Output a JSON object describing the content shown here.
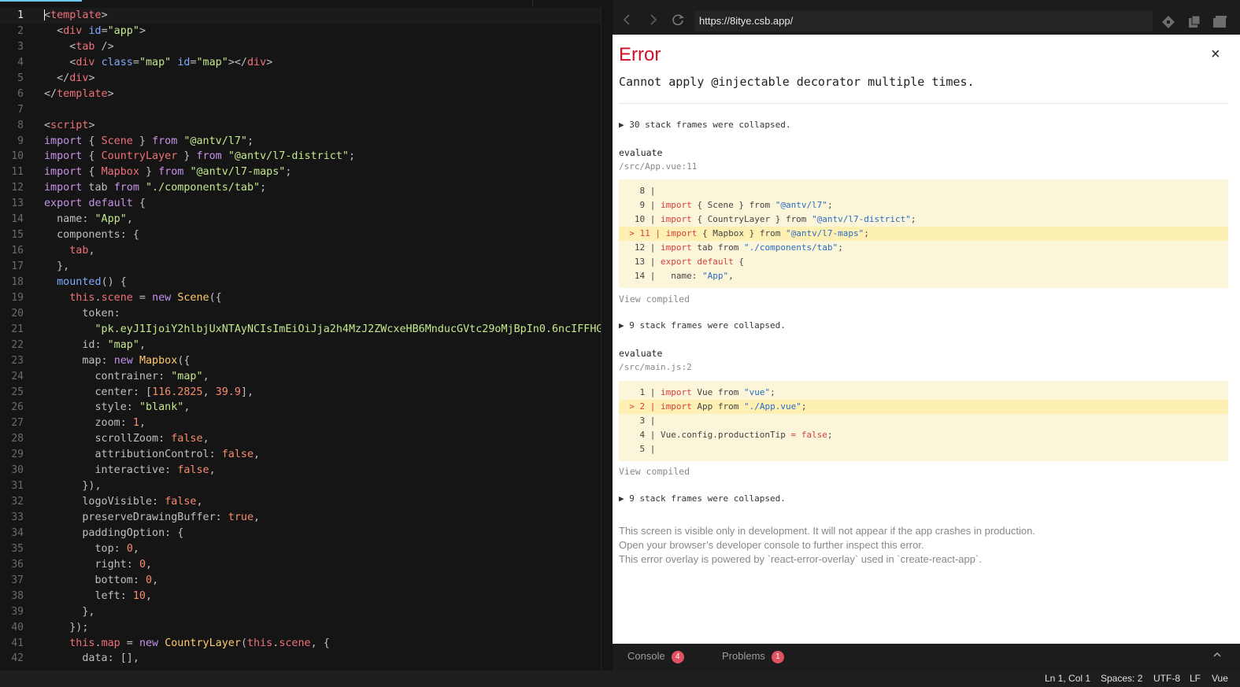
{
  "editor": {
    "lines": [
      {
        "n": "1",
        "tokens": [
          [
            "t-punc",
            "<"
          ],
          [
            "t-tag",
            "template"
          ],
          [
            "t-punc",
            ">"
          ]
        ]
      },
      {
        "n": "2",
        "tokens": [
          [
            "t-punc",
            "  <"
          ],
          [
            "t-tag",
            "div"
          ],
          [
            "t-punc",
            " "
          ],
          [
            "t-attr",
            "id"
          ],
          [
            "t-punc",
            "="
          ],
          [
            "t-str",
            "\"app\""
          ],
          [
            "t-punc",
            ">"
          ]
        ]
      },
      {
        "n": "3",
        "tokens": [
          [
            "t-punc",
            "    <"
          ],
          [
            "t-tag",
            "tab"
          ],
          [
            "t-punc",
            " />"
          ]
        ]
      },
      {
        "n": "4",
        "tokens": [
          [
            "t-punc",
            "    <"
          ],
          [
            "t-tag",
            "div"
          ],
          [
            "t-punc",
            " "
          ],
          [
            "t-attr",
            "class"
          ],
          [
            "t-punc",
            "="
          ],
          [
            "t-str",
            "\"map\""
          ],
          [
            "t-punc",
            " "
          ],
          [
            "t-attr",
            "id"
          ],
          [
            "t-punc",
            "="
          ],
          [
            "t-str",
            "\"map\""
          ],
          [
            "t-punc",
            "></"
          ],
          [
            "t-tag",
            "div"
          ],
          [
            "t-punc",
            ">"
          ]
        ]
      },
      {
        "n": "5",
        "tokens": [
          [
            "t-punc",
            "  </"
          ],
          [
            "t-tag",
            "div"
          ],
          [
            "t-punc",
            ">"
          ]
        ]
      },
      {
        "n": "6",
        "tokens": [
          [
            "t-punc",
            "</"
          ],
          [
            "t-tag",
            "template"
          ],
          [
            "t-punc",
            ">"
          ]
        ]
      },
      {
        "n": "7",
        "tokens": []
      },
      {
        "n": "8",
        "tokens": [
          [
            "t-punc",
            "<"
          ],
          [
            "t-tag",
            "script"
          ],
          [
            "t-punc",
            ">"
          ]
        ]
      },
      {
        "n": "9",
        "tokens": [
          [
            "t-kw",
            "import"
          ],
          [
            "t-punc",
            " { "
          ],
          [
            "t-this",
            "Scene"
          ],
          [
            "t-punc",
            " } "
          ],
          [
            "t-kw",
            "from"
          ],
          [
            "t-punc",
            " "
          ],
          [
            "t-str",
            "\"@antv/l7\""
          ],
          [
            "t-punc",
            ";"
          ]
        ]
      },
      {
        "n": "10",
        "tokens": [
          [
            "t-kw",
            "import"
          ],
          [
            "t-punc",
            " { "
          ],
          [
            "t-this",
            "CountryLayer"
          ],
          [
            "t-punc",
            " } "
          ],
          [
            "t-kw",
            "from"
          ],
          [
            "t-punc",
            " "
          ],
          [
            "t-str",
            "\"@antv/l7-district\""
          ],
          [
            "t-punc",
            ";"
          ]
        ]
      },
      {
        "n": "11",
        "tokens": [
          [
            "t-kw",
            "import"
          ],
          [
            "t-punc",
            " { "
          ],
          [
            "t-this",
            "Mapbox"
          ],
          [
            "t-punc",
            " } "
          ],
          [
            "t-kw",
            "from"
          ],
          [
            "t-punc",
            " "
          ],
          [
            "t-str",
            "\"@antv/l7-maps\""
          ],
          [
            "t-punc",
            ";"
          ]
        ]
      },
      {
        "n": "12",
        "tokens": [
          [
            "t-kw",
            "import"
          ],
          [
            "t-punc",
            " tab "
          ],
          [
            "t-kw",
            "from"
          ],
          [
            "t-punc",
            " "
          ],
          [
            "t-str",
            "\"./components/tab\""
          ],
          [
            "t-punc",
            ";"
          ]
        ]
      },
      {
        "n": "13",
        "tokens": [
          [
            "t-kw",
            "export"
          ],
          [
            "t-punc",
            " "
          ],
          [
            "t-kw",
            "default"
          ],
          [
            "t-punc",
            " {"
          ]
        ]
      },
      {
        "n": "14",
        "tokens": [
          [
            "t-punc",
            "  name: "
          ],
          [
            "t-str",
            "\"App\""
          ],
          [
            "t-punc",
            ","
          ]
        ]
      },
      {
        "n": "15",
        "tokens": [
          [
            "t-punc",
            "  components: {"
          ]
        ]
      },
      {
        "n": "16",
        "tokens": [
          [
            "t-this",
            "    tab"
          ],
          [
            "t-punc",
            ","
          ]
        ]
      },
      {
        "n": "17",
        "tokens": [
          [
            "t-punc",
            "  },"
          ]
        ]
      },
      {
        "n": "18",
        "tokens": [
          [
            "t-fn",
            "  mounted"
          ],
          [
            "t-punc",
            "() {"
          ]
        ]
      },
      {
        "n": "19",
        "tokens": [
          [
            "t-this",
            "    this"
          ],
          [
            "t-punc",
            "."
          ],
          [
            "t-this",
            "scene"
          ],
          [
            "t-punc",
            " = "
          ],
          [
            "t-kw",
            "new"
          ],
          [
            "t-punc",
            " "
          ],
          [
            "t-cls",
            "Scene"
          ],
          [
            "t-punc",
            "({"
          ]
        ]
      },
      {
        "n": "20",
        "tokens": [
          [
            "t-punc",
            "      token:"
          ]
        ]
      },
      {
        "n": "21",
        "tokens": [
          [
            "t-str",
            "        \"pk.eyJ1IjoiY2hlbjUxNTAyNCIsImEiOiJja2h4MzJ2ZWcxeHB6MnducGVtc29oMjBpIn0.6ncIFFHG"
          ]
        ]
      },
      {
        "n": "22",
        "tokens": [
          [
            "t-punc",
            "      id: "
          ],
          [
            "t-str",
            "\"map\""
          ],
          [
            "t-punc",
            ","
          ]
        ]
      },
      {
        "n": "23",
        "tokens": [
          [
            "t-punc",
            "      map: "
          ],
          [
            "t-kw",
            "new"
          ],
          [
            "t-punc",
            " "
          ],
          [
            "t-cls",
            "Mapbox"
          ],
          [
            "t-punc",
            "({"
          ]
        ]
      },
      {
        "n": "24",
        "tokens": [
          [
            "t-punc",
            "        contrainer: "
          ],
          [
            "t-str",
            "\"map\""
          ],
          [
            "t-punc",
            ","
          ]
        ]
      },
      {
        "n": "25",
        "tokens": [
          [
            "t-punc",
            "        center: ["
          ],
          [
            "t-num",
            "116.2825"
          ],
          [
            "t-punc",
            ", "
          ],
          [
            "t-num",
            "39.9"
          ],
          [
            "t-punc",
            "],"
          ]
        ]
      },
      {
        "n": "26",
        "tokens": [
          [
            "t-punc",
            "        style: "
          ],
          [
            "t-str",
            "\"blank\""
          ],
          [
            "t-punc",
            ","
          ]
        ]
      },
      {
        "n": "27",
        "tokens": [
          [
            "t-punc",
            "        zoom: "
          ],
          [
            "t-num",
            "1"
          ],
          [
            "t-punc",
            ","
          ]
        ]
      },
      {
        "n": "28",
        "tokens": [
          [
            "t-punc",
            "        scrollZoom: "
          ],
          [
            "t-bool",
            "false"
          ],
          [
            "t-punc",
            ","
          ]
        ]
      },
      {
        "n": "29",
        "tokens": [
          [
            "t-punc",
            "        attributionControl: "
          ],
          [
            "t-bool",
            "false"
          ],
          [
            "t-punc",
            ","
          ]
        ]
      },
      {
        "n": "30",
        "tokens": [
          [
            "t-punc",
            "        interactive: "
          ],
          [
            "t-bool",
            "false"
          ],
          [
            "t-punc",
            ","
          ]
        ]
      },
      {
        "n": "31",
        "tokens": [
          [
            "t-punc",
            "      }),"
          ]
        ]
      },
      {
        "n": "32",
        "tokens": [
          [
            "t-punc",
            "      logoVisible: "
          ],
          [
            "t-bool",
            "false"
          ],
          [
            "t-punc",
            ","
          ]
        ]
      },
      {
        "n": "33",
        "tokens": [
          [
            "t-punc",
            "      preserveDrawingBuffer: "
          ],
          [
            "t-bool",
            "true"
          ],
          [
            "t-punc",
            ","
          ]
        ]
      },
      {
        "n": "34",
        "tokens": [
          [
            "t-punc",
            "      paddingOption: {"
          ]
        ]
      },
      {
        "n": "35",
        "tokens": [
          [
            "t-punc",
            "        top: "
          ],
          [
            "t-num",
            "0"
          ],
          [
            "t-punc",
            ","
          ]
        ]
      },
      {
        "n": "36",
        "tokens": [
          [
            "t-punc",
            "        right: "
          ],
          [
            "t-num",
            "0"
          ],
          [
            "t-punc",
            ","
          ]
        ]
      },
      {
        "n": "37",
        "tokens": [
          [
            "t-punc",
            "        bottom: "
          ],
          [
            "t-num",
            "0"
          ],
          [
            "t-punc",
            ","
          ]
        ]
      },
      {
        "n": "38",
        "tokens": [
          [
            "t-punc",
            "        left: "
          ],
          [
            "t-num",
            "10"
          ],
          [
            "t-punc",
            ","
          ]
        ]
      },
      {
        "n": "39",
        "tokens": [
          [
            "t-punc",
            "      },"
          ]
        ]
      },
      {
        "n": "40",
        "tokens": [
          [
            "t-punc",
            "    });"
          ]
        ]
      },
      {
        "n": "41",
        "tokens": [
          [
            "t-this",
            "    this"
          ],
          [
            "t-punc",
            "."
          ],
          [
            "t-this",
            "map"
          ],
          [
            "t-punc",
            " = "
          ],
          [
            "t-kw",
            "new"
          ],
          [
            "t-punc",
            " "
          ],
          [
            "t-cls",
            "CountryLayer"
          ],
          [
            "t-punc",
            "("
          ],
          [
            "t-this",
            "this"
          ],
          [
            "t-punc",
            "."
          ],
          [
            "t-this",
            "scene"
          ],
          [
            "t-punc",
            ", {"
          ]
        ]
      },
      {
        "n": "42",
        "tokens": [
          [
            "t-punc",
            "      data: [],"
          ]
        ]
      }
    ]
  },
  "browser": {
    "url": "https://8itye.csb.app/",
    "back_icon": "chevron-left-icon",
    "forward_icon": "chevron-right-icon",
    "reload_icon": "reload-icon"
  },
  "overlay": {
    "title": "Error",
    "close": "×",
    "message": "Cannot apply @injectable decorator multiple times.",
    "collapsed1": "▶ 30 stack frames were collapsed.",
    "frame1_name": "evaluate",
    "frame1_file": "/src/App.vue:11",
    "snippet1": [
      {
        "hl": false,
        "t": [
          [
            "p",
            "    8 | "
          ]
        ]
      },
      {
        "hl": false,
        "t": [
          [
            "p",
            "    9 | "
          ],
          [
            "r",
            "import"
          ],
          [
            "p",
            " { Scene } from "
          ],
          [
            "b",
            "\"@antv/l7\""
          ],
          [
            "p",
            ";"
          ]
        ]
      },
      {
        "hl": false,
        "t": [
          [
            "p",
            "   10 | "
          ],
          [
            "r",
            "import"
          ],
          [
            "p",
            " { CountryLayer } from "
          ],
          [
            "b",
            "\"@antv/l7-district\""
          ],
          [
            "p",
            ";"
          ]
        ]
      },
      {
        "hl": true,
        "t": [
          [
            "r",
            "  > 11 | "
          ],
          [
            "r",
            "import"
          ],
          [
            "p",
            " { Mapbox } from "
          ],
          [
            "b",
            "\"@antv/l7-maps\""
          ],
          [
            "p",
            ";"
          ]
        ]
      },
      {
        "hl": false,
        "t": [
          [
            "p",
            "   12 | "
          ],
          [
            "r",
            "import"
          ],
          [
            "p",
            " tab from "
          ],
          [
            "b",
            "\"./components/tab\""
          ],
          [
            "p",
            ";"
          ]
        ]
      },
      {
        "hl": false,
        "t": [
          [
            "p",
            "   13 | "
          ],
          [
            "r",
            "export default"
          ],
          [
            "p",
            " {"
          ]
        ]
      },
      {
        "hl": false,
        "t": [
          [
            "p",
            "   14 |   name: "
          ],
          [
            "b",
            "\"App\""
          ],
          [
            "p",
            ","
          ]
        ]
      }
    ],
    "view_compiled": "View compiled",
    "collapsed2": "▶ 9 stack frames were collapsed.",
    "frame2_name": "evaluate",
    "frame2_file": "/src/main.js:2",
    "snippet2": [
      {
        "hl": false,
        "t": [
          [
            "p",
            "    1 | "
          ],
          [
            "r",
            "import"
          ],
          [
            "p",
            " Vue from "
          ],
          [
            "b",
            "\"vue\""
          ],
          [
            "p",
            ";"
          ]
        ]
      },
      {
        "hl": true,
        "t": [
          [
            "r",
            "  > 2 | "
          ],
          [
            "r",
            "import"
          ],
          [
            "p",
            " App from "
          ],
          [
            "b",
            "\"./App.vue\""
          ],
          [
            "p",
            ";"
          ]
        ]
      },
      {
        "hl": false,
        "t": [
          [
            "p",
            "    3 | "
          ]
        ]
      },
      {
        "hl": false,
        "t": [
          [
            "p",
            "    4 | Vue.config.productionTip "
          ],
          [
            "r",
            "="
          ],
          [
            "p",
            " "
          ],
          [
            "r",
            "false"
          ],
          [
            "p",
            ";"
          ]
        ]
      },
      {
        "hl": false,
        "t": [
          [
            "p",
            "    5 | "
          ]
        ]
      }
    ],
    "collapsed3": "▶ 9 stack frames were collapsed.",
    "note1": "This screen is visible only in development. It will not appear if the app crashes in production.",
    "note2": "Open your browser’s developer console to further inspect this error.",
    "note3": "This error overlay is powered by `react-error-overlay` used in `create-react-app`."
  },
  "console_bar": {
    "console_label": "Console",
    "console_count": "4",
    "problems_label": "Problems",
    "problems_count": "1",
    "badge_color": "#e05260"
  },
  "status_bar": {
    "position": "Ln 1, Col 1",
    "spaces": "Spaces: 2",
    "encoding": "UTF-8",
    "eol": "LF",
    "language": "Vue"
  }
}
